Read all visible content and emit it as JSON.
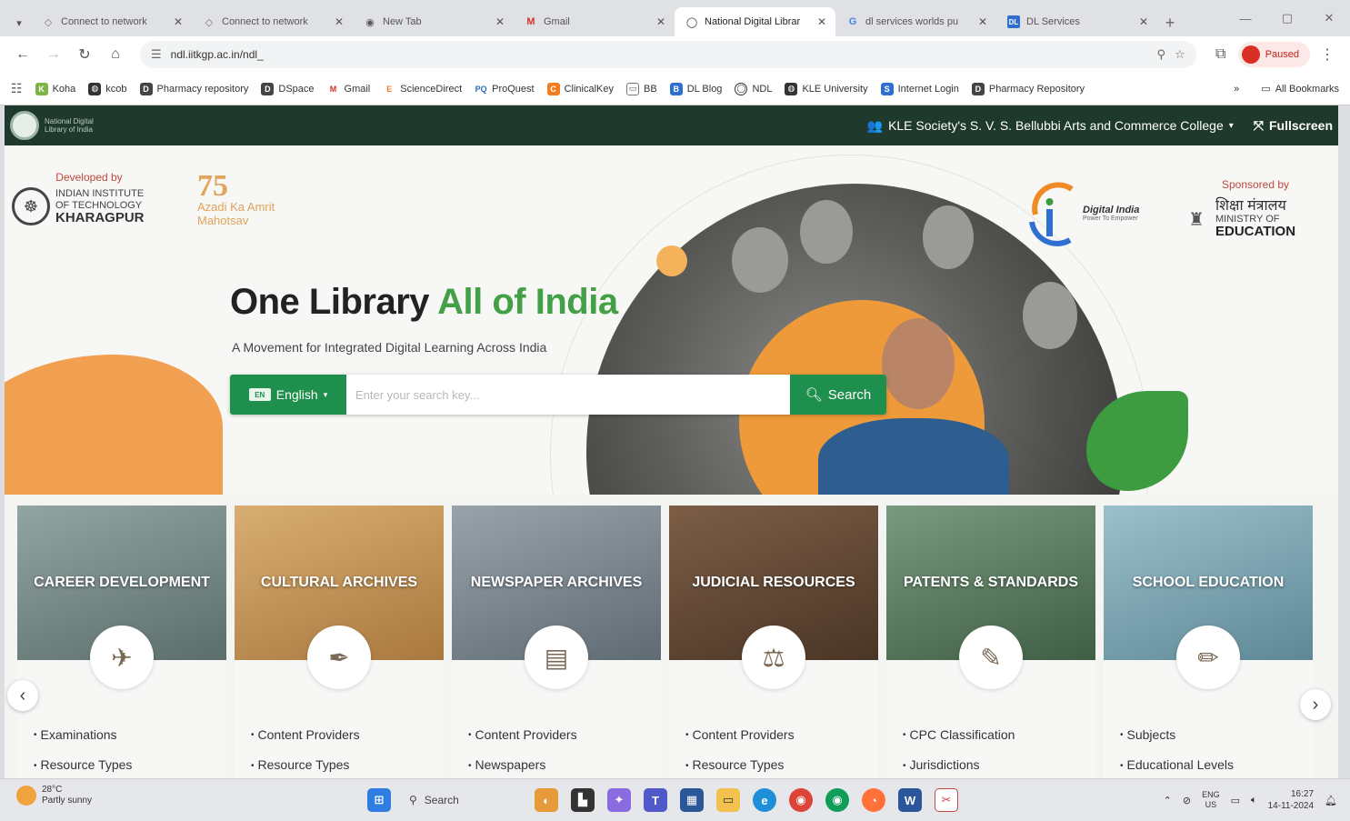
{
  "browser": {
    "tabs": [
      {
        "title": "Connect to network",
        "active": false
      },
      {
        "title": "Connect to network",
        "active": false
      },
      {
        "title": "New Tab",
        "active": false
      },
      {
        "title": "Gmail",
        "active": false
      },
      {
        "title": "National Digital Librar",
        "active": true
      },
      {
        "title": "dl services worlds pu",
        "active": false
      },
      {
        "title": "DL Services",
        "active": false
      }
    ],
    "url": "ndl.iitkgp.ac.in/ndl_",
    "profile_label": "Paused",
    "bookmarks": [
      "Koha",
      "kcob",
      "Pharmacy repository",
      "DSpace",
      "Gmail",
      "ScienceDirect",
      "ProQuest",
      "ClinicalKey",
      "BB",
      "DL Blog",
      "NDL",
      "KLE University",
      "Internet Login",
      "Pharmacy Repository"
    ],
    "bookmarks_all": "All Bookmarks",
    "bookmarks_more": "»"
  },
  "header": {
    "logo_text": "National Digital Library of India",
    "institution": "KLE Society's S. V. S. Bellubbi Arts and Commerce College",
    "fullscreen": "Fullscreen"
  },
  "banner": {
    "developed_by": "Developed by",
    "iit_line1": "INDIAN INSTITUTE",
    "iit_line2": "OF TECHNOLOGY",
    "iit_line3": "KHARAGPUR",
    "azadi_num": "75",
    "azadi_text": "Azadi Ka Amrit Mahotsav",
    "digital_india": "Digital India",
    "digital_india_sub": "Power To Empower",
    "sponsored_by": "Sponsored by",
    "moe_hindi": "शिक्षा मंत्रालय",
    "moe_line1": "MINISTRY OF",
    "moe_line2": "EDUCATION",
    "headline_dark": "One Library ",
    "headline_green": "All of India",
    "tagline": "A Movement for Integrated Digital Learning Across India"
  },
  "search": {
    "language": "English",
    "placeholder": "Enter your search key...",
    "button": "Search"
  },
  "cards": [
    {
      "title": "CAREER DEVELOPMENT",
      "bg": "#7d8f8c",
      "icon": "career-icon",
      "glyph": "✈",
      "links": [
        "Examinations",
        "Resource Types"
      ]
    },
    {
      "title": "CULTURAL ARCHIVES",
      "bg": "#c89a5e",
      "icon": "quill-icon",
      "glyph": "✒",
      "links": [
        "Content Providers",
        "Resource Types"
      ]
    },
    {
      "title": "NEWSPAPER ARCHIVES",
      "bg": "#7f8a93",
      "icon": "newspaper-icon",
      "glyph": "▤",
      "links": [
        "Content Providers",
        "Newspapers"
      ]
    },
    {
      "title": "JUDICIAL RESOURCES",
      "bg": "#6b4f3a",
      "icon": "scales-icon",
      "glyph": "⚖",
      "links": [
        "Content Providers",
        "Resource Types"
      ]
    },
    {
      "title": "PATENTS & STANDARDS",
      "bg": "#5d8063",
      "icon": "patent-icon",
      "glyph": "✎",
      "links": [
        "CPC Classification",
        "Jurisdictions"
      ]
    },
    {
      "title": "SCHOOL EDUCATION",
      "bg": "#7ea7b4",
      "icon": "school-icon",
      "glyph": "✏",
      "links": [
        "Subjects",
        "Educational Levels"
      ]
    }
  ],
  "taskbar": {
    "temp": "28°C",
    "weather": "Partly sunny",
    "search": "Search",
    "lang1": "ENG",
    "lang2": "US",
    "time": "16:27",
    "date": "14-11-2024"
  }
}
